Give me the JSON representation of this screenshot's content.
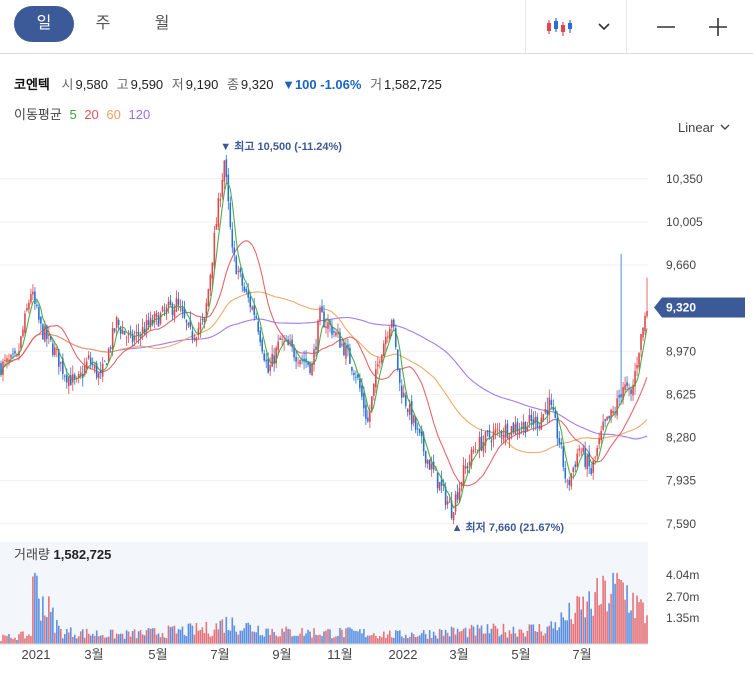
{
  "tabs": [
    {
      "label": "일",
      "active": true
    },
    {
      "label": "주",
      "active": false
    },
    {
      "label": "월",
      "active": false
    }
  ],
  "toolbar": {
    "chart_type_icon": "candlestick-icon",
    "dropdown_icon": "chevron-down-icon",
    "zoom_out_icon": "minus-icon",
    "zoom_in_icon": "plus-icon"
  },
  "quote": {
    "name": "코엔텍",
    "open_label": "시",
    "open": "9,580",
    "high_label": "고",
    "high": "9,590",
    "low_label": "저",
    "low": "9,190",
    "close_label": "종",
    "close": "9,320",
    "change": "▼100 -1.06%",
    "volume_label": "거",
    "volume": "1,582,725"
  },
  "ma": {
    "label": "이동평균",
    "periods": [
      {
        "label": "5",
        "color": "#3aa53a"
      },
      {
        "label": "20",
        "color": "#e0565b"
      },
      {
        "label": "60",
        "color": "#f0a15a"
      },
      {
        "label": "120",
        "color": "#9b6ee8"
      }
    ]
  },
  "scale_button": "Linear",
  "colors": {
    "up": "#e0474c",
    "down": "#2b6fd6",
    "accent": "#3d5a98",
    "price_tag": "#3d5a98"
  },
  "chart_data": {
    "type": "candlestick",
    "y_ticks": [
      "10,350",
      "10,005",
      "9,660",
      "8,970",
      "8,625",
      "8,280",
      "7,935",
      "7,590"
    ],
    "ylim": [
      7500,
      10700
    ],
    "x_labels": [
      "2021",
      "3월",
      "5월",
      "7월",
      "9월",
      "11월",
      "2022",
      "3월",
      "5월",
      "7월"
    ],
    "last_price": "9,320",
    "max_annotation": "▼ 최고 10,500 (-11.24%)",
    "min_annotation": "▲ 최저 7,660 (21.67%)",
    "volume_label": "거래량",
    "volume_value": "1,582,725",
    "volume_ticks": [
      "4.04m",
      "2.70m",
      "1.35m"
    ],
    "price_path": [
      [
        0,
        8850
      ],
      [
        8,
        8900
      ],
      [
        15,
        9450
      ],
      [
        20,
        9150
      ],
      [
        26,
        9000
      ],
      [
        32,
        8800
      ],
      [
        38,
        8700
      ],
      [
        44,
        8900
      ],
      [
        50,
        8750
      ],
      [
        58,
        9200
      ],
      [
        65,
        9050
      ],
      [
        72,
        9150
      ],
      [
        80,
        9250
      ],
      [
        88,
        9350
      ],
      [
        95,
        9100
      ],
      [
        102,
        9200
      ],
      [
        108,
        10000
      ],
      [
        112,
        10500
      ],
      [
        116,
        9750
      ],
      [
        122,
        9450
      ],
      [
        128,
        9250
      ],
      [
        134,
        8800
      ],
      [
        140,
        9050
      ],
      [
        148,
        8950
      ],
      [
        156,
        8850
      ],
      [
        160,
        9250
      ],
      [
        166,
        9150
      ],
      [
        172,
        9000
      ],
      [
        178,
        8800
      ],
      [
        184,
        8400
      ],
      [
        190,
        8950
      ],
      [
        196,
        9250
      ],
      [
        200,
        8700
      ],
      [
        208,
        8350
      ],
      [
        214,
        8100
      ],
      [
        220,
        7900
      ],
      [
        226,
        7700
      ],
      [
        232,
        8000
      ],
      [
        238,
        8200
      ],
      [
        246,
        8300
      ],
      [
        254,
        8350
      ],
      [
        262,
        8380
      ],
      [
        270,
        8420
      ],
      [
        275,
        8550
      ],
      [
        280,
        8250
      ],
      [
        284,
        7880
      ],
      [
        290,
        8200
      ],
      [
        296,
        8000
      ],
      [
        302,
        8350
      ],
      [
        308,
        8500
      ],
      [
        312,
        8700
      ],
      [
        316,
        8600
      ],
      [
        320,
        9000
      ],
      [
        324,
        9320
      ]
    ],
    "spikes": [
      [
        274,
        8600
      ],
      [
        311,
        9750
      ],
      [
        324,
        9560
      ]
    ],
    "volume_path": [
      [
        0,
        0.1
      ],
      [
        15,
        0.15
      ],
      [
        16,
        1.0
      ],
      [
        30,
        0.2
      ],
      [
        60,
        0.15
      ],
      [
        106,
        0.25
      ],
      [
        112,
        0.35
      ],
      [
        140,
        0.2
      ],
      [
        184,
        0.18
      ],
      [
        200,
        0.15
      ],
      [
        226,
        0.2
      ],
      [
        274,
        0.25
      ],
      [
        311,
        0.95
      ],
      [
        324,
        0.45
      ]
    ]
  }
}
